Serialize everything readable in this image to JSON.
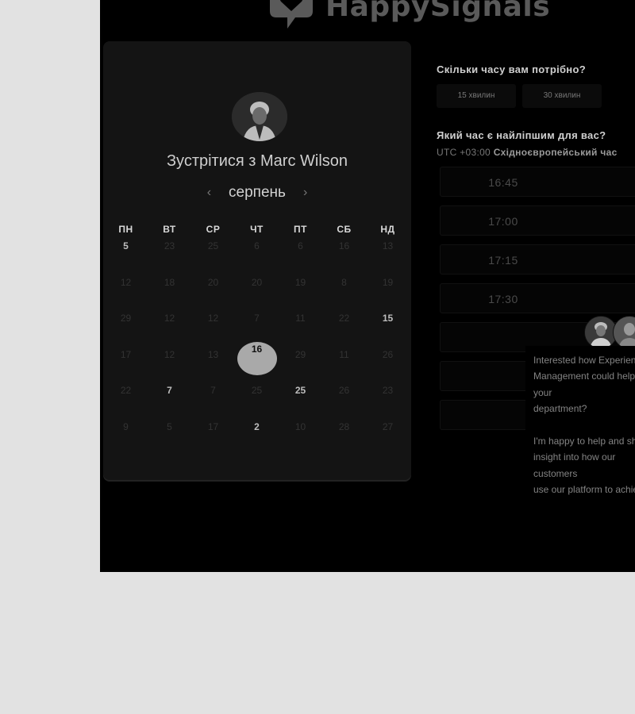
{
  "brand": {
    "name": "HappySignals"
  },
  "calendar": {
    "title": "Зустрітися з Marc Wilson",
    "month": "серпень",
    "prev_icon": "‹",
    "next_icon": "›",
    "weekdays": [
      "ПН",
      "ВТ",
      "СР",
      "ЧТ",
      "ПТ",
      "СБ",
      "НД"
    ],
    "weeks": [
      [
        {
          "d": "5",
          "s": "active"
        },
        {
          "d": "23",
          "s": "off"
        },
        {
          "d": "25",
          "s": "off"
        },
        {
          "d": "6",
          "s": "off"
        },
        {
          "d": "6",
          "s": "off"
        },
        {
          "d": "16",
          "s": "off"
        },
        {
          "d": "13",
          "s": "off"
        }
      ],
      [
        {
          "d": "12",
          "s": "off"
        },
        {
          "d": "18",
          "s": "off"
        },
        {
          "d": "20",
          "s": "off"
        },
        {
          "d": "20",
          "s": "off"
        },
        {
          "d": "19",
          "s": "off"
        },
        {
          "d": "8",
          "s": "off"
        },
        {
          "d": "19",
          "s": "off"
        }
      ],
      [
        {
          "d": "29",
          "s": "off"
        },
        {
          "d": "12",
          "s": "off"
        },
        {
          "d": "12",
          "s": "off"
        },
        {
          "d": "7",
          "s": "off"
        },
        {
          "d": "11",
          "s": "off"
        },
        {
          "d": "22",
          "s": "off"
        },
        {
          "d": "15",
          "s": "active"
        }
      ],
      [
        {
          "d": "17",
          "s": "off"
        },
        {
          "d": "12",
          "s": "off"
        },
        {
          "d": "13",
          "s": "off"
        },
        {
          "d": "16",
          "s": "selected"
        },
        {
          "d": "29",
          "s": "off"
        },
        {
          "d": "11",
          "s": "off"
        },
        {
          "d": "26",
          "s": "off"
        }
      ],
      [
        {
          "d": "22",
          "s": "off"
        },
        {
          "d": "7",
          "s": "active"
        },
        {
          "d": "7",
          "s": "off"
        },
        {
          "d": "25",
          "s": "off"
        },
        {
          "d": "25",
          "s": "active"
        },
        {
          "d": "26",
          "s": "off"
        },
        {
          "d": "23",
          "s": "off"
        }
      ],
      [
        {
          "d": "9",
          "s": "off"
        },
        {
          "d": "5",
          "s": "off"
        },
        {
          "d": "17",
          "s": "off"
        },
        {
          "d": "2",
          "s": "active"
        },
        {
          "d": "10",
          "s": "off"
        },
        {
          "d": "28",
          "s": "off"
        },
        {
          "d": "27",
          "s": "off"
        }
      ]
    ]
  },
  "duration": {
    "question": "Скільки часу вам потрібно?",
    "options": [
      "15 хвилин",
      "30 хвилин"
    ]
  },
  "time": {
    "question": "Який час є найліпшим для вас?",
    "tz_offset": "UTC +03:00",
    "tz_name": "Східноєвропейський час",
    "slots": [
      "16:45",
      "17:00",
      "17:15",
      "17:30",
      "",
      "",
      ""
    ]
  },
  "chat": {
    "message": "Interested how Experience\nManagement could help your\ndepartment?\n\nI'm happy to help and share\ninsight into how our customers\nuse our platform to achieve\nimprovement in IT end-user\nproductivity"
  }
}
